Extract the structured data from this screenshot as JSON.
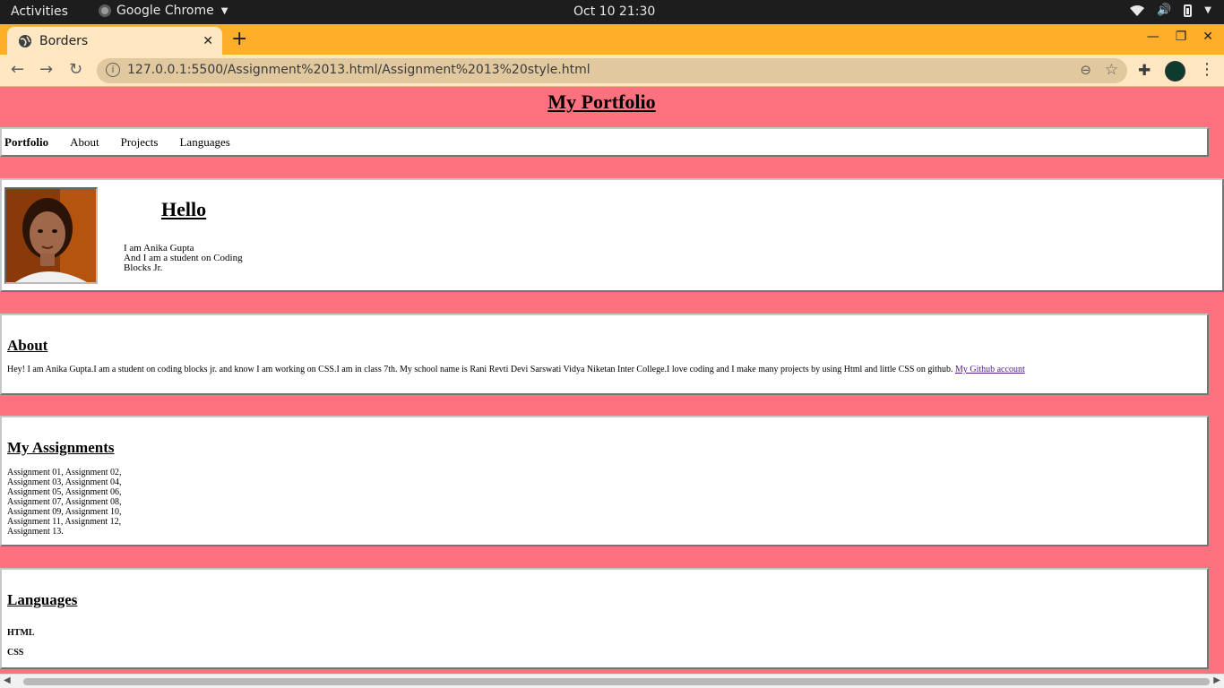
{
  "system": {
    "activities": "Activities",
    "app_name": "Google Chrome",
    "clock": "Oct 10  21:30"
  },
  "browser": {
    "tab_title": "Borders",
    "url": "127.0.0.1:5500/Assignment%2013.html/Assignment%2013%20style.html"
  },
  "page": {
    "title": "My Portfolio",
    "nav": {
      "brand": "Portfolio",
      "items": [
        "About",
        "Projects",
        "Languages"
      ]
    },
    "hello": {
      "heading": "Hello",
      "line1": "I am Anika Gupta",
      "line2": "And I am a student on Coding",
      "line3": "Blocks Jr."
    },
    "about": {
      "heading": "About",
      "text": "Hey! I am Anika Gupta.I am a student on coding blocks jr. and know I am working on CSS.I am in class 7th. My school name is Rani Revti Devi Sarswati Vidya Niketan Inter College.I love coding and I make many projects by using Html and little CSS on github. ",
      "link": "My Github account"
    },
    "assignments": {
      "heading": "My Assignments",
      "lines": [
        "Assignment 01, Assignment 02,",
        "Assignment 03, Assignment 04,",
        "Assignment 05, Assignment 06,",
        "Assignment 07, Assignment 08,",
        "Assignment 09, Assignment 10,",
        "Assignment 11, Assignment 12,",
        "Assignment 13."
      ]
    },
    "languages": {
      "heading": "Languages",
      "items": [
        "HTML",
        "CSS"
      ]
    }
  },
  "colors": {
    "page_bg": "#fe717f",
    "tab_strip": "#ffae2a",
    "toolbar": "#ffe7c2"
  }
}
